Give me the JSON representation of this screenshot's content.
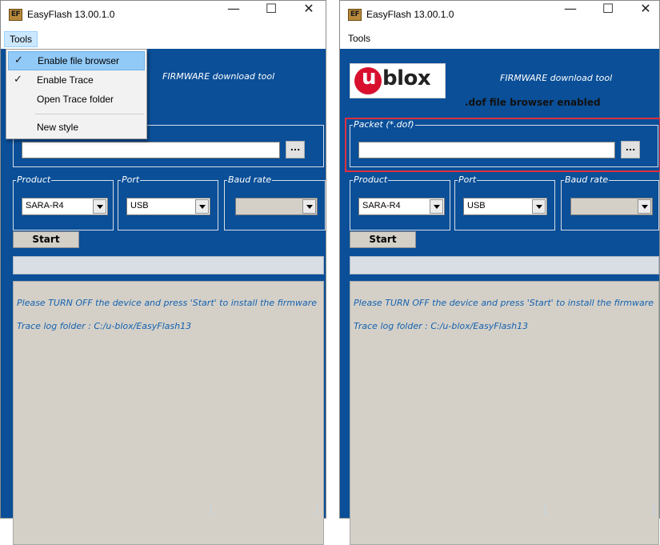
{
  "left_window": {
    "title": "EasyFlash 13.00.1.0",
    "icon_text": "EF",
    "menu": {
      "tools_label": "Tools"
    },
    "dropdown": {
      "items": [
        {
          "label": "Enable file browser",
          "checked": true
        },
        {
          "label": "Enable Trace",
          "checked": true
        },
        {
          "label": "Open Trace folder",
          "checked": false
        },
        {
          "label": "New style",
          "checked": false
        }
      ]
    },
    "tagline": "FIRMWARE download tool",
    "browse_label": "...",
    "product": {
      "legend": "Product",
      "value": "SARA-R4"
    },
    "port": {
      "legend": "Port",
      "value": "USB"
    },
    "baud": {
      "legend": "Baud rate",
      "value": ""
    },
    "start_label": "Start",
    "log_lines": [
      "Please TURN OFF the device and press 'Start' to install the firmware",
      "Trace log folder : C:/u-blox/EasyFlash13"
    ]
  },
  "right_window": {
    "title": "EasyFlash 13.00.1.0",
    "icon_text": "EF",
    "menu": {
      "tools_label": "Tools"
    },
    "logo": {
      "u_text": "u",
      "blox_text": "blox"
    },
    "tagline": "FIRMWARE download tool",
    "status_message": ".dof file browser enabled",
    "packet": {
      "legend": "Packet (*.dof)",
      "value": ""
    },
    "browse_label": "...",
    "product": {
      "legend": "Product",
      "value": "SARA-R4"
    },
    "port": {
      "legend": "Port",
      "value": "USB"
    },
    "baud": {
      "legend": "Baud rate",
      "value": ""
    },
    "start_label": "Start",
    "log_lines": [
      "Please TURN OFF the device and press 'Start' to install the firmware",
      "Trace log folder : C:/u-blox/EasyFlash13"
    ]
  },
  "caption_buttons": {
    "minimize": "—",
    "maximize": "☐",
    "close": "✕"
  },
  "colors": {
    "panel_blue": "#0a4f98",
    "log_text": "#1462b0",
    "highlight_red": "#e03040",
    "menu_highlight": "#91c9f7"
  },
  "icons": {
    "check": "✓"
  }
}
